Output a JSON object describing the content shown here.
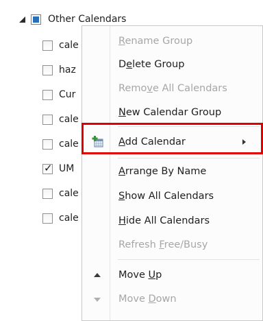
{
  "tree": {
    "group_label": "Other Calendars",
    "items": [
      {
        "label": "cale",
        "checked": false
      },
      {
        "label": "haz",
        "checked": false
      },
      {
        "label": "Cur",
        "checked": false
      },
      {
        "label": "cale",
        "checked": false
      },
      {
        "label": "cale",
        "checked": false
      },
      {
        "label": "UM",
        "checked": true
      },
      {
        "label": "cale",
        "checked": false
      },
      {
        "label": "cale",
        "checked": false
      }
    ]
  },
  "menu": {
    "rename_group": {
      "pre": "",
      "u": "R",
      "post": "ename Group"
    },
    "delete_group": {
      "pre": "D",
      "u": "e",
      "post": "lete Group"
    },
    "remove_all": {
      "pre": "Remo",
      "u": "v",
      "post": "e All Calendars"
    },
    "new_group": {
      "pre": "",
      "u": "N",
      "post": "ew Calendar Group"
    },
    "add_calendar": {
      "pre": "",
      "u": "A",
      "post": "dd Calendar"
    },
    "arrange_by_name": {
      "pre": "",
      "u": "A",
      "post": "rrange By Name"
    },
    "show_all": {
      "pre": "",
      "u": "S",
      "post": "how All Calendars"
    },
    "hide_all": {
      "pre": "",
      "u": "H",
      "post": "ide All Calendars"
    },
    "refresh": {
      "pre": "Refresh ",
      "u": "F",
      "post": "ree/Busy"
    },
    "move_up": {
      "pre": "Move ",
      "u": "U",
      "post": "p"
    },
    "move_down": {
      "pre": "Move ",
      "u": "D",
      "post": "own"
    }
  },
  "icons": {
    "add_calendar": "calendar-add-icon",
    "move_up": "triangle-up-icon",
    "move_down": "triangle-down-icon"
  },
  "colors": {
    "highlight": "#e00000",
    "disabled_text": "#a6a6a6",
    "group_checkbox": "#2a6fb8"
  }
}
